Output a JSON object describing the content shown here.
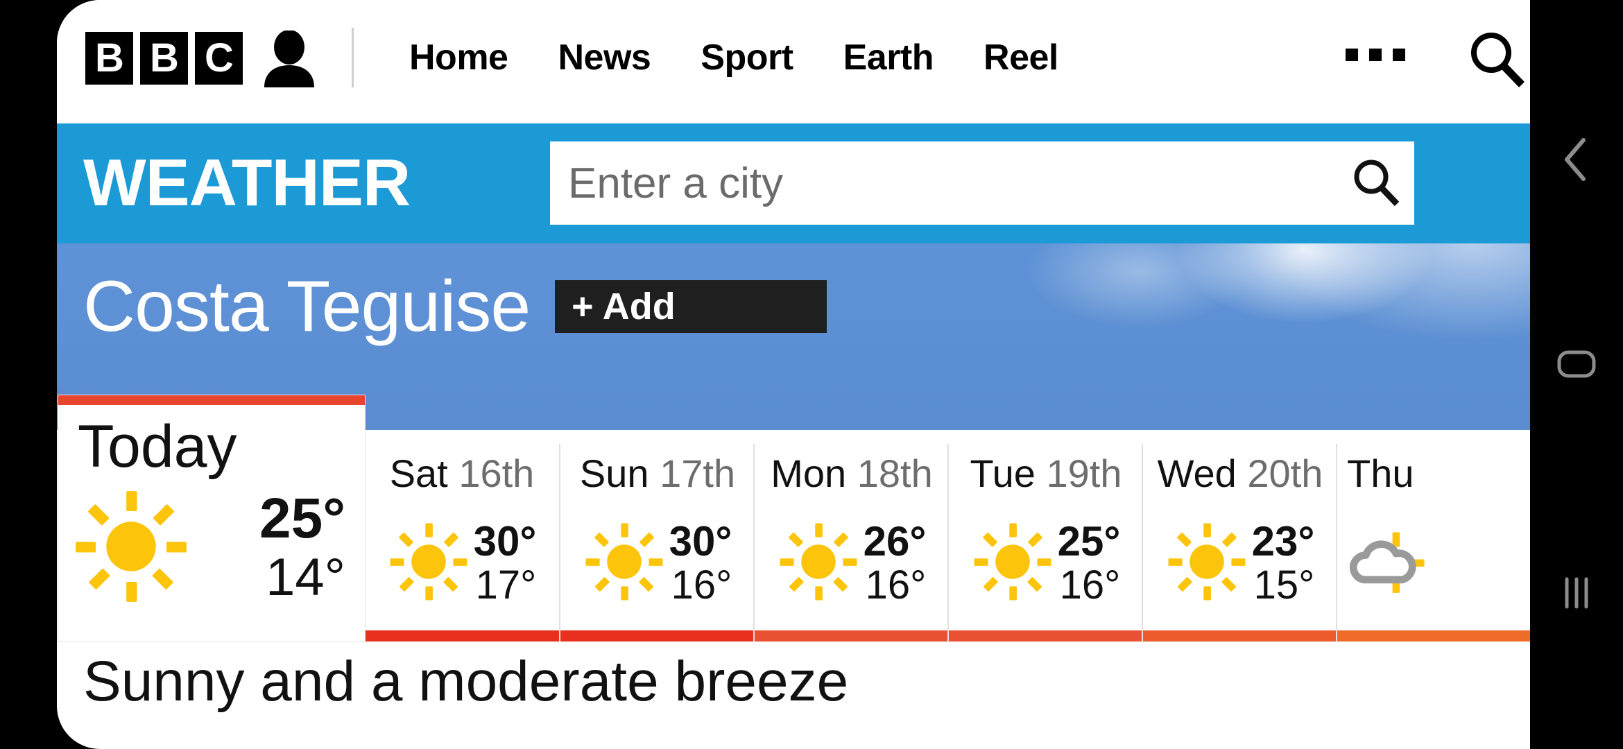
{
  "browser": {
    "header": {
      "logo_letters": [
        "B",
        "B",
        "C"
      ],
      "account_icon": "account-icon",
      "links": [
        {
          "label": "Home"
        },
        {
          "label": "News"
        },
        {
          "label": "Sport"
        },
        {
          "label": "Earth"
        },
        {
          "label": "Reel"
        }
      ],
      "more_icon": "more-ellipsis-icon",
      "search_icon": "search-icon"
    }
  },
  "weather": {
    "wordmark": "WEATHER",
    "search": {
      "value": "",
      "placeholder": "Enter a city",
      "icon": "search-icon"
    },
    "location": {
      "name": "Costa Teguise",
      "add_label": "+ Add"
    },
    "today": {
      "label": "Today",
      "icon": "sunny-icon",
      "high": "25°",
      "low": "14°",
      "accent_color": "#e8452f"
    },
    "days": [
      {
        "name": "Sat",
        "date": "16th",
        "icon": "sunny-icon",
        "high": "30°",
        "low": "17°",
        "accent_color": "#e8301f"
      },
      {
        "name": "Sun",
        "date": "17th",
        "icon": "sunny-icon",
        "high": "30°",
        "low": "16°",
        "accent_color": "#e8301f"
      },
      {
        "name": "Mon",
        "date": "18th",
        "icon": "sunny-icon",
        "high": "26°",
        "low": "16°",
        "accent_color": "#ea5132"
      },
      {
        "name": "Tue",
        "date": "19th",
        "icon": "sunny-icon",
        "high": "25°",
        "low": "16°",
        "accent_color": "#ea5132"
      },
      {
        "name": "Wed",
        "date": "20th",
        "icon": "sunny-icon",
        "high": "23°",
        "low": "15°",
        "accent_color": "#ee5b2c"
      },
      {
        "name": "Thu",
        "date": "",
        "icon": "sunny-intervals-icon",
        "high": "",
        "low": "",
        "accent_color": "#ef6b2a"
      }
    ],
    "summary": "Sunny and a moderate breeze"
  },
  "system_nav": {
    "back_icon": "chevron-back-icon",
    "home_icon": "home-square-icon",
    "recents_icon": "recents-bars-icon"
  },
  "colors": {
    "brand_blue": "#1b9ad6",
    "sky_blue": "#5e92d6",
    "sun_yellow": "#fcc50b",
    "dark": "#1f1f1f"
  }
}
